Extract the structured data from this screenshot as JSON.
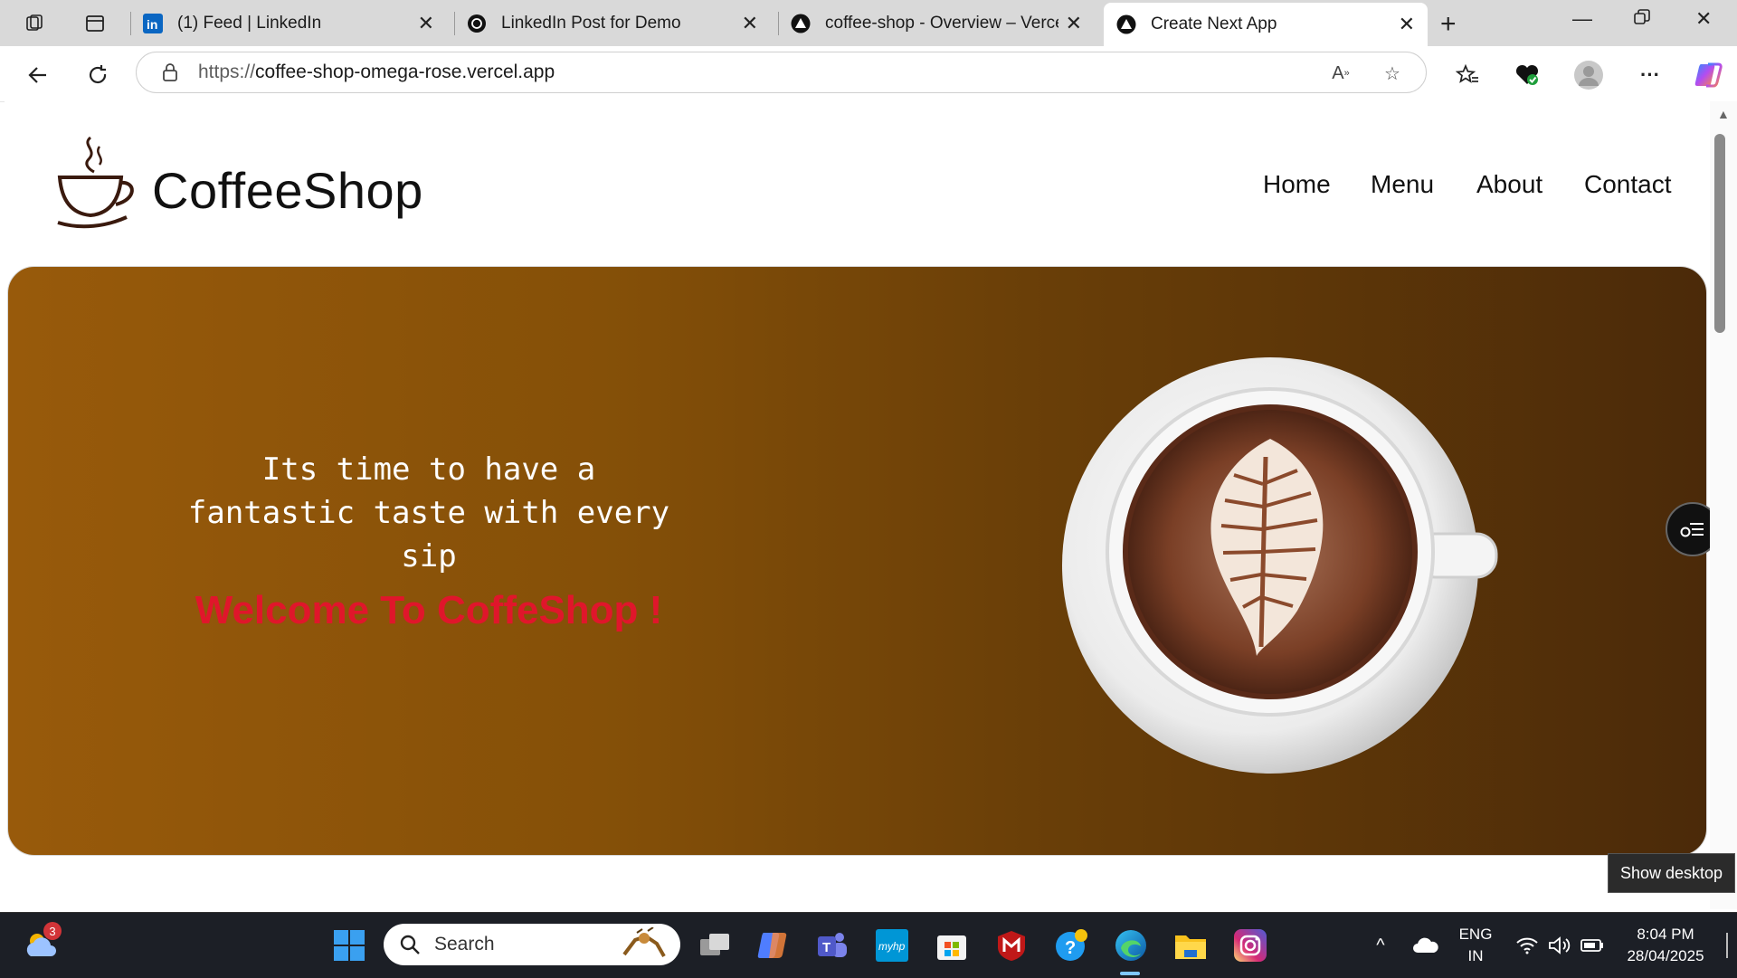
{
  "browser": {
    "tabs": [
      {
        "title": "(1) Feed | LinkedIn",
        "icon": "linkedin-icon"
      },
      {
        "title": "LinkedIn Post for Demo",
        "icon": "chatgpt-icon"
      },
      {
        "title": "coffee-shop - Overview – Vercel",
        "icon": "vercel-icon"
      },
      {
        "title": "Create Next App",
        "icon": "vercel-icon",
        "active": true
      }
    ],
    "address": {
      "scheme": "https://",
      "host": "coffee-shop-omega-rose.vercel.app"
    }
  },
  "site": {
    "brand": "CoffeeShop",
    "nav": [
      "Home",
      "Menu",
      "About",
      "Contact"
    ],
    "hero": {
      "tagline": "Its time to have a fantastic taste with every sip",
      "welcome": "Welcome To CoffeShop !"
    }
  },
  "tooltip": "Show desktop",
  "taskbar": {
    "weather_badge": "3",
    "search_placeholder": "Search",
    "language": "ENG",
    "region": "IN",
    "time": "8:04 PM",
    "date": "28/04/2025"
  },
  "colors": {
    "hero_start": "#985a0b",
    "hero_end": "#4b2a09",
    "welcome_text": "#e0162b",
    "taskbar": "#1c1f26"
  }
}
